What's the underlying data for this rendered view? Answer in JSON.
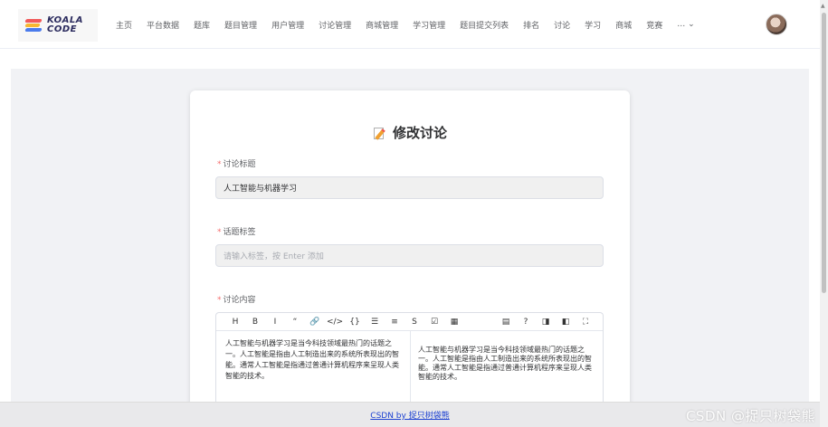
{
  "brand": {
    "line1": "KOALA",
    "line2": "CODE"
  },
  "nav": {
    "items": [
      "主页",
      "平台数据",
      "题库",
      "题目管理",
      "用户管理",
      "讨论管理",
      "商城管理",
      "学习管理",
      "题目提交列表",
      "排名",
      "讨论",
      "学习",
      "商城",
      "竞赛"
    ],
    "more": "… ⌄"
  },
  "page": {
    "title": "修改讨论"
  },
  "form": {
    "required_mark": "*",
    "title_label": "讨论标题",
    "title_value": "人工智能与机器学习",
    "tags_label": "话题标签",
    "tags_placeholder": "请输入标签，按 Enter 添加",
    "content_label": "讨论内容"
  },
  "editor": {
    "toolbar_left": [
      {
        "icon": "heading-icon",
        "glyph": "H"
      },
      {
        "icon": "bold-icon",
        "glyph": "B"
      },
      {
        "icon": "italic-icon",
        "glyph": "I"
      },
      {
        "icon": "quote-icon",
        "glyph": "“"
      },
      {
        "icon": "link-icon",
        "glyph": "🔗"
      },
      {
        "icon": "code-icon",
        "glyph": "</>"
      },
      {
        "icon": "code-block-icon",
        "glyph": "{}"
      },
      {
        "icon": "unordered-list-icon",
        "glyph": "☰"
      },
      {
        "icon": "ordered-list-icon",
        "glyph": "≡"
      },
      {
        "icon": "strikethrough-icon",
        "glyph": "S"
      },
      {
        "icon": "task-list-icon",
        "glyph": "☑"
      },
      {
        "icon": "table-icon",
        "glyph": "▦"
      }
    ],
    "toolbar_right": [
      {
        "icon": "toc-icon",
        "glyph": "▤"
      },
      {
        "icon": "help-icon",
        "glyph": "?"
      },
      {
        "icon": "preview-only-icon",
        "glyph": "◨"
      },
      {
        "icon": "split-view-icon",
        "glyph": "◧"
      },
      {
        "icon": "fullscreen-icon",
        "glyph": "⛶"
      }
    ],
    "source_text": "人工智能与机器学习是当今科技领域最热门的话题之一。人工智能是指由人工制造出来的系统所表现出的智能。通常人工智能是指通过普通计算机程序来呈现人类智能的技术。",
    "preview_text": "人工智能与机器学习是当今科技领域最热门的话题之一。人工智能是指由人工制造出来的系统所表现出的智能。通常人工智能是指通过普通计算机程序来呈现人类智能的技术。"
  },
  "footer": {
    "link_text": "CSDN by 捉只树袋熊"
  },
  "watermark": "CSDN @捉只树袋熊"
}
